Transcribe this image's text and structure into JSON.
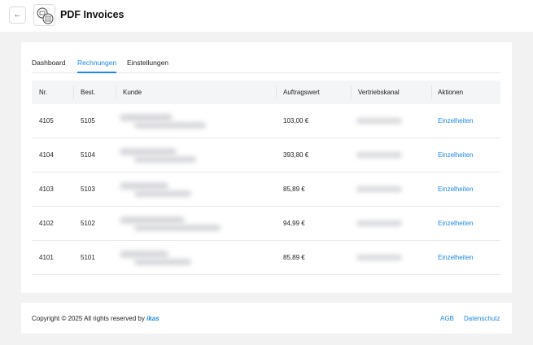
{
  "header": {
    "back_icon": "arrow-left-icon",
    "app_icon": "pdf-invoices-logo-icon",
    "title": "PDF Invoices"
  },
  "tabs": [
    {
      "label": "Dashboard",
      "active": false
    },
    {
      "label": "Rechnungen",
      "active": true
    },
    {
      "label": "Einstellungen",
      "active": false
    }
  ],
  "table": {
    "columns": [
      "Nr.",
      "Best.",
      "Kunde",
      "Auftragswert",
      "Vertriebskanal",
      "Aktionen"
    ],
    "rows": [
      {
        "nr": "4105",
        "best": "5105",
        "auftragswert": "103,00 €",
        "aktion": "Einzelheiten"
      },
      {
        "nr": "4104",
        "best": "5104",
        "auftragswert": "393,80 €",
        "aktion": "Einzelheiten"
      },
      {
        "nr": "4103",
        "best": "5103",
        "auftragswert": "85,89 €",
        "aktion": "Einzelheiten"
      },
      {
        "nr": "4102",
        "best": "5102",
        "auftragswert": "94,99 €",
        "aktion": "Einzelheiten"
      },
      {
        "nr": "4101",
        "best": "5101",
        "auftragswert": "85,89 €",
        "aktion": "Einzelheiten"
      }
    ]
  },
  "footer": {
    "copyright": "Copyright © 2025 All rights reserved by",
    "brand": "ikas",
    "links": [
      "AGB",
      "Datenschutz"
    ]
  },
  "colors": {
    "accent": "#1e88e5",
    "background": "#f2f2f3"
  }
}
